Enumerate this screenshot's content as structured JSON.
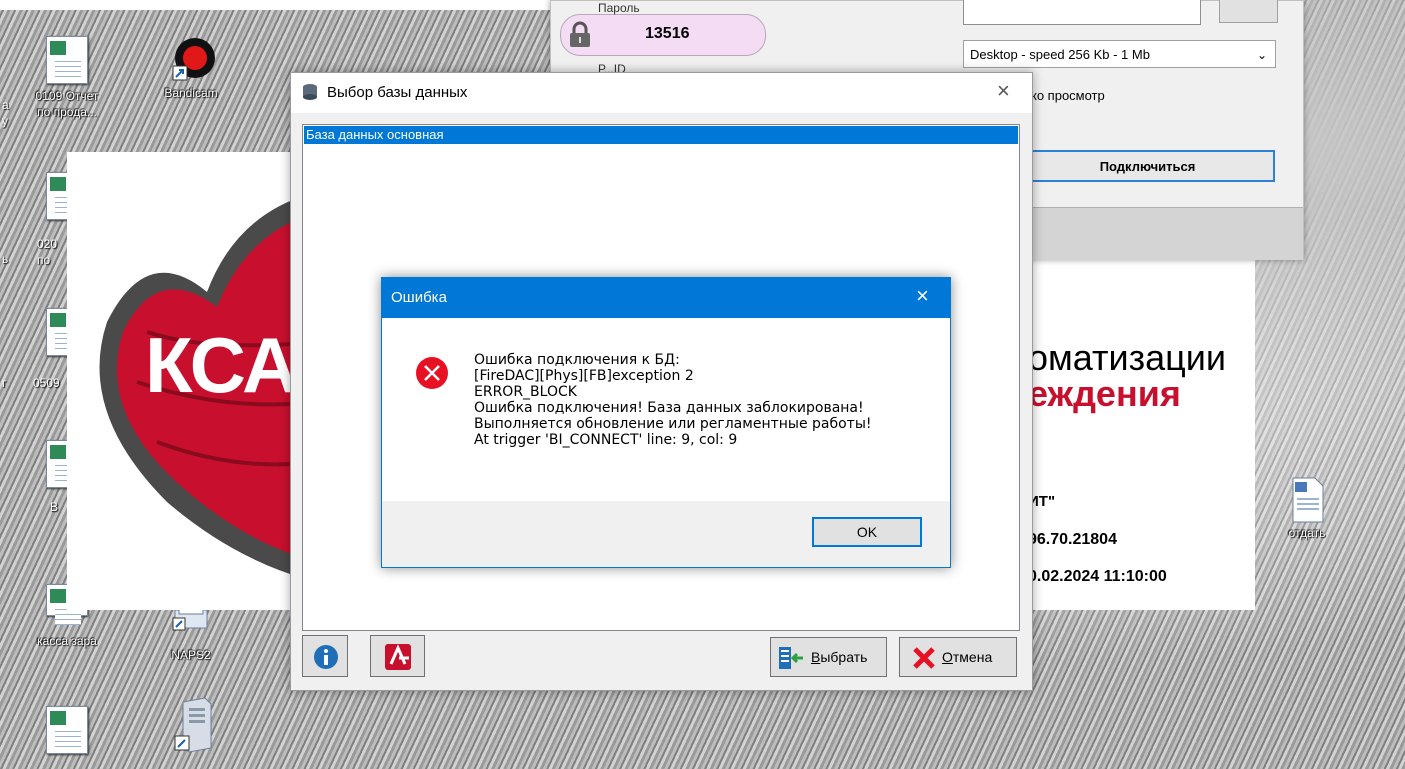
{
  "desktop": {
    "icons": [
      {
        "label_1": "0109 Отчет",
        "label_2": "по прода..."
      },
      {
        "label_1": "Bandicam",
        "label_2": ""
      },
      {
        "label_1": "020",
        "label_2": "по"
      },
      {
        "label_1": "0509",
        "label_2": ""
      },
      {
        "label_1": "В",
        "label_2": ""
      },
      {
        "label_1": "касса зара",
        "label_2": ""
      },
      {
        "label_1": "NAPS2",
        "label_2": ""
      },
      {
        "label_1": "отдать",
        "label_2": ""
      }
    ],
    "left_edge_fragments": [
      "а",
      "у",
      "ь",
      "г"
    ]
  },
  "banner": {
    "logo_text": "КСА"
  },
  "product_panel": {
    "line1": "оматизации",
    "line2": "еждения",
    "line3": "ИТ\"",
    "line4": "96.70.21804",
    "line5": "0.02.2024 11:10:00"
  },
  "conn_window": {
    "password_label": "Пароль",
    "password_value": "13516",
    "below_password_fragment": "Р...ID",
    "speed_value": "Desktop - speed  256 Kb - 1 Mb",
    "readonly_label": "ко просмотр",
    "connect_label": "Подключиться"
  },
  "db_dialog": {
    "title": "Выбор базы данных",
    "list_items": [
      "База данных основная"
    ],
    "select_label": "Выбрать",
    "select_underline": "В",
    "select_rest": "ыбрать",
    "cancel_underline": "О",
    "cancel_rest": "тмена"
  },
  "error_dialog": {
    "title": "Ошибка",
    "lines": [
      "Ошибка подключения к БД:",
      "[FireDAC][Phys][FB]exception 2",
      "ERROR_BLOCK",
      "Ошибка подключения! База данных заблокирована!",
      "Выполняется обновление или регламентные работы!",
      "At trigger 'BI_CONNECT' line: 9, col: 9"
    ],
    "ok_label": "OK"
  },
  "colors": {
    "accent": "#0078d7",
    "error_red": "#e81123",
    "banner_red": "#c8102e",
    "password_pill": "#f5dcf5"
  }
}
